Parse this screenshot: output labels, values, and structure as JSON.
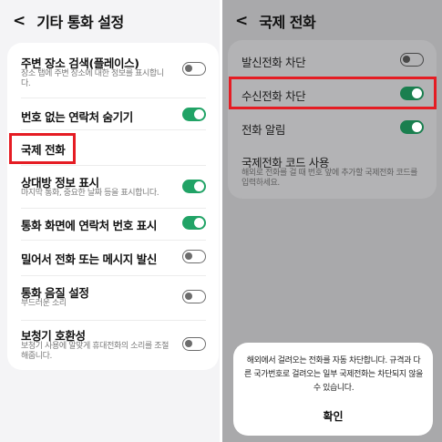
{
  "left": {
    "title": "기타 통화 설정",
    "items": [
      {
        "label": "주변 장소 검색(플레이스)",
        "desc": "장소 탭에 주변 장소에 대한 정보를 표시합니다.",
        "toggle": false
      },
      {
        "label": "번호 없는 연락처 숨기기",
        "desc": "",
        "toggle": true
      },
      {
        "label": "국제 전화",
        "desc": "",
        "toggle": null
      },
      {
        "label": "상대방 정보 표시",
        "desc": "마지막 통화, 중요한 날짜 등을 표시합니다.",
        "toggle": true
      },
      {
        "label": "통화 화면에 연락처 번호 표시",
        "desc": "",
        "toggle": true
      },
      {
        "label": "밀어서 전화 또는 메시지 발신",
        "desc": "",
        "toggle": false
      },
      {
        "label": "통화 음질 설정",
        "desc": "부드러운 소리",
        "toggle": false
      },
      {
        "label": "보청기 호환성",
        "desc": "보청기 사용에 알맞게 휴대전화의 소리를 조절해줍니다.",
        "toggle": false
      }
    ]
  },
  "right": {
    "title": "국제 전화",
    "items": [
      {
        "label": "발신전화 차단",
        "desc": "",
        "toggle": false
      },
      {
        "label": "수신전화 차단",
        "desc": "",
        "toggle": true
      },
      {
        "label": "전화 알림",
        "desc": "",
        "toggle": true
      },
      {
        "label": "국제전화 코드 사용",
        "desc": "해외로 전화를 걸 때 번호 앞에 추가할 국제전화 코드를 입력하세요.",
        "toggle": null
      }
    ],
    "dialog": {
      "message": "해외에서 걸려오는 전화를 자동 차단합니다. 규격과 다른 국가번호로 걸려오는 일부 국제전화는 차단되지 않을 수 있습니다.",
      "confirm": "확인"
    }
  },
  "colors": {
    "toggle_on": "#21a366",
    "highlight": "#e51c23"
  },
  "icons": {
    "back": "chevron-left-icon"
  },
  "glyphs": {
    "back": "<"
  }
}
